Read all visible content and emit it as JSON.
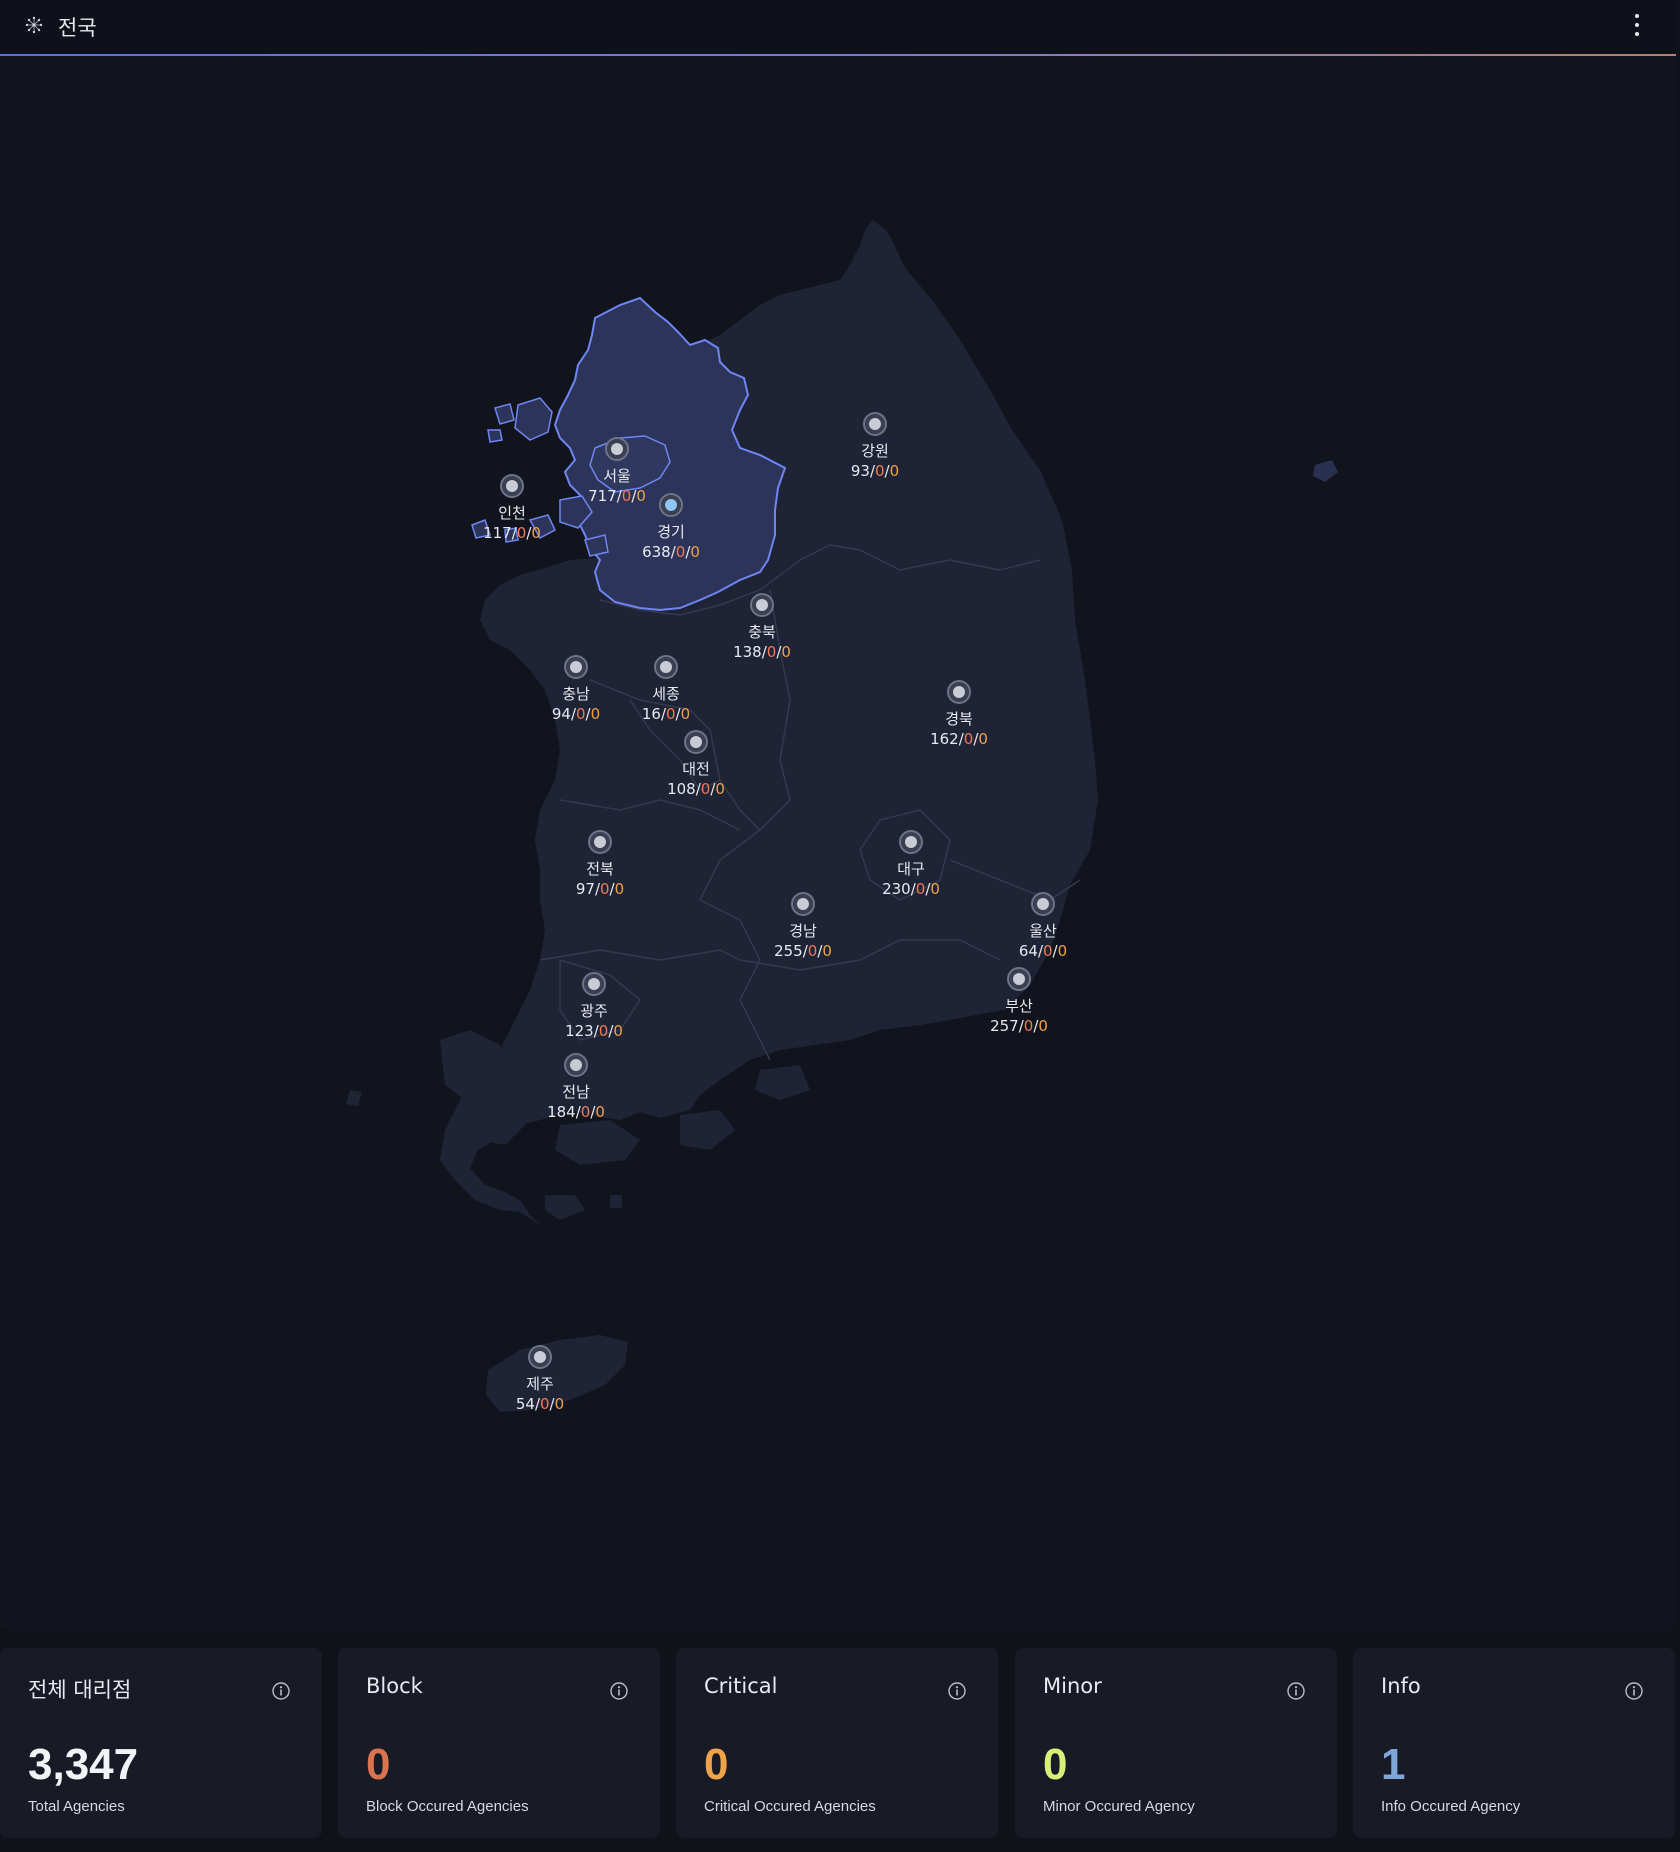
{
  "header": {
    "title": "전국",
    "icon": "network-icon",
    "menu_icon": "more-vertical-icon"
  },
  "colors": {
    "block": "#f07a55",
    "critical": "#f0a24a",
    "minor": "#d8f07a",
    "info": "#7fa6d8",
    "highlight": "#6f86f2"
  },
  "regions": [
    {
      "id": "seoul",
      "name": "서울",
      "total": "717",
      "block": "0",
      "critical": "0"
    },
    {
      "id": "gyeonggi",
      "name": "경기",
      "total": "638",
      "block": "0",
      "critical": "0"
    },
    {
      "id": "incheon",
      "name": "인천",
      "total": "117",
      "block": "0",
      "critical": "0"
    },
    {
      "id": "gangwon",
      "name": "강원",
      "total": "93",
      "block": "0",
      "critical": "0"
    },
    {
      "id": "chungbuk",
      "name": "충북",
      "total": "138",
      "block": "0",
      "critical": "0"
    },
    {
      "id": "chungnam",
      "name": "충남",
      "total": "94",
      "block": "0",
      "critical": "0"
    },
    {
      "id": "sejong",
      "name": "세종",
      "total": "16",
      "block": "0",
      "critical": "0"
    },
    {
      "id": "daejeon",
      "name": "대전",
      "total": "108",
      "block": "0",
      "critical": "0"
    },
    {
      "id": "gyeongbuk",
      "name": "경북",
      "total": "162",
      "block": "0",
      "critical": "0"
    },
    {
      "id": "jeonbuk",
      "name": "전북",
      "total": "97",
      "block": "0",
      "critical": "0"
    },
    {
      "id": "daegu",
      "name": "대구",
      "total": "230",
      "block": "0",
      "critical": "0"
    },
    {
      "id": "gyeongnam",
      "name": "경남",
      "total": "255",
      "block": "0",
      "critical": "0"
    },
    {
      "id": "ulsan",
      "name": "울산",
      "total": "64",
      "block": "0",
      "critical": "0"
    },
    {
      "id": "gwangju",
      "name": "광주",
      "total": "123",
      "block": "0",
      "critical": "0"
    },
    {
      "id": "busan",
      "name": "부산",
      "total": "257",
      "block": "0",
      "critical": "0"
    },
    {
      "id": "jeonnam",
      "name": "전남",
      "total": "184",
      "block": "0",
      "critical": "0"
    },
    {
      "id": "jeju",
      "name": "제주",
      "total": "54",
      "block": "0",
      "critical": "0"
    }
  ],
  "cards": [
    {
      "title": "전체 대리점",
      "value": "3,347",
      "sub": "Total Agencies",
      "color": "#f2f3f7"
    },
    {
      "title": "Block",
      "value": "0",
      "sub": "Block Occured Agencies",
      "color": "#d9744e"
    },
    {
      "title": "Critical",
      "value": "0",
      "sub": "Critical Occured Agencies",
      "color": "#f0a24a"
    },
    {
      "title": "Minor",
      "value": "0",
      "sub": "Minor Occured Agency",
      "color": "#d8f07a"
    },
    {
      "title": "Info",
      "value": "1",
      "sub": "Info Occured Agency",
      "color": "#7fa6d8"
    }
  ]
}
